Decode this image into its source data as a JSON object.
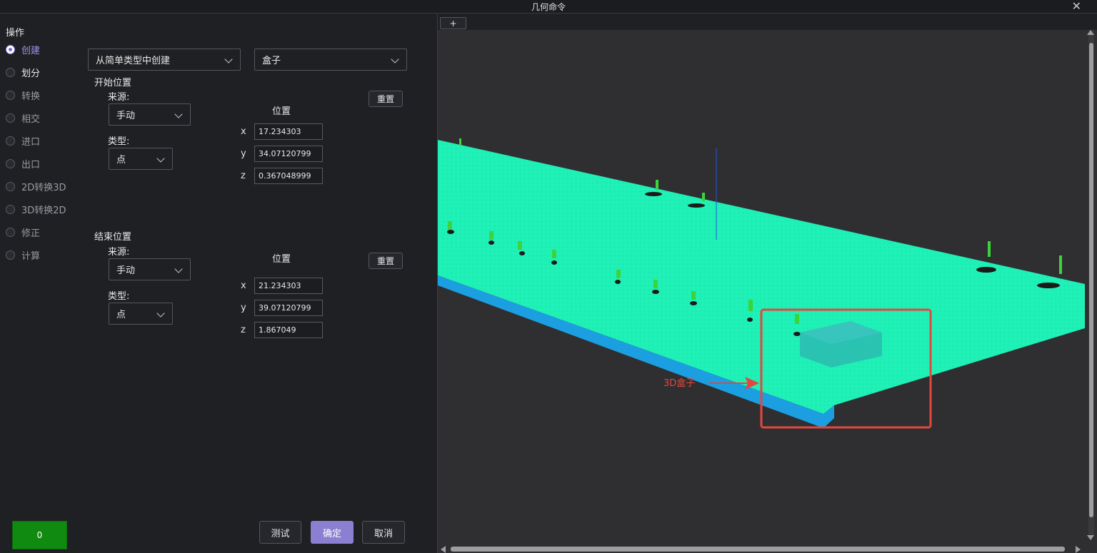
{
  "window": {
    "title": "几何命令",
    "close_glyph": "✕"
  },
  "operations": {
    "header": "操作",
    "items": [
      {
        "label": "创建",
        "checked": true
      },
      {
        "label": "划分",
        "checked": false
      },
      {
        "label": "转换",
        "checked": false
      },
      {
        "label": "相交",
        "checked": false
      },
      {
        "label": "进口",
        "checked": false
      },
      {
        "label": "出口",
        "checked": false
      },
      {
        "label": "2D转换3D",
        "checked": false
      },
      {
        "label": "3D转换2D",
        "checked": false
      },
      {
        "label": "修正",
        "checked": false
      },
      {
        "label": "计算",
        "checked": false
      }
    ]
  },
  "create": {
    "method": "从简单类型中创建",
    "shape": "盒子"
  },
  "start": {
    "title": "开始位置",
    "source_label": "来源:",
    "source": "手动",
    "type_label": "类型:",
    "type": "点",
    "position_label": "位置",
    "reset": "重置",
    "x": "17.234303",
    "y": "34.07120799",
    "z": "0.367048999"
  },
  "end": {
    "title": "结束位置",
    "source_label": "来源:",
    "source": "手动",
    "type_label": "类型:",
    "type": "点",
    "position_label": "位置",
    "reset": "重置",
    "x": "21.234303",
    "y": "39.07120799",
    "z": "1.867049"
  },
  "axes": {
    "x": "x",
    "y": "y",
    "z": "z"
  },
  "footer": {
    "counter": "0",
    "test": "测试",
    "ok": "确定",
    "cancel": "取消"
  },
  "viewport": {
    "tab_plus": "+",
    "annotation": "3D盒子"
  },
  "colors": {
    "accent": "#8a7fd0",
    "point_cloud": "#1ef0b4",
    "annotation": "#e3473f",
    "counter": "#108a10"
  }
}
